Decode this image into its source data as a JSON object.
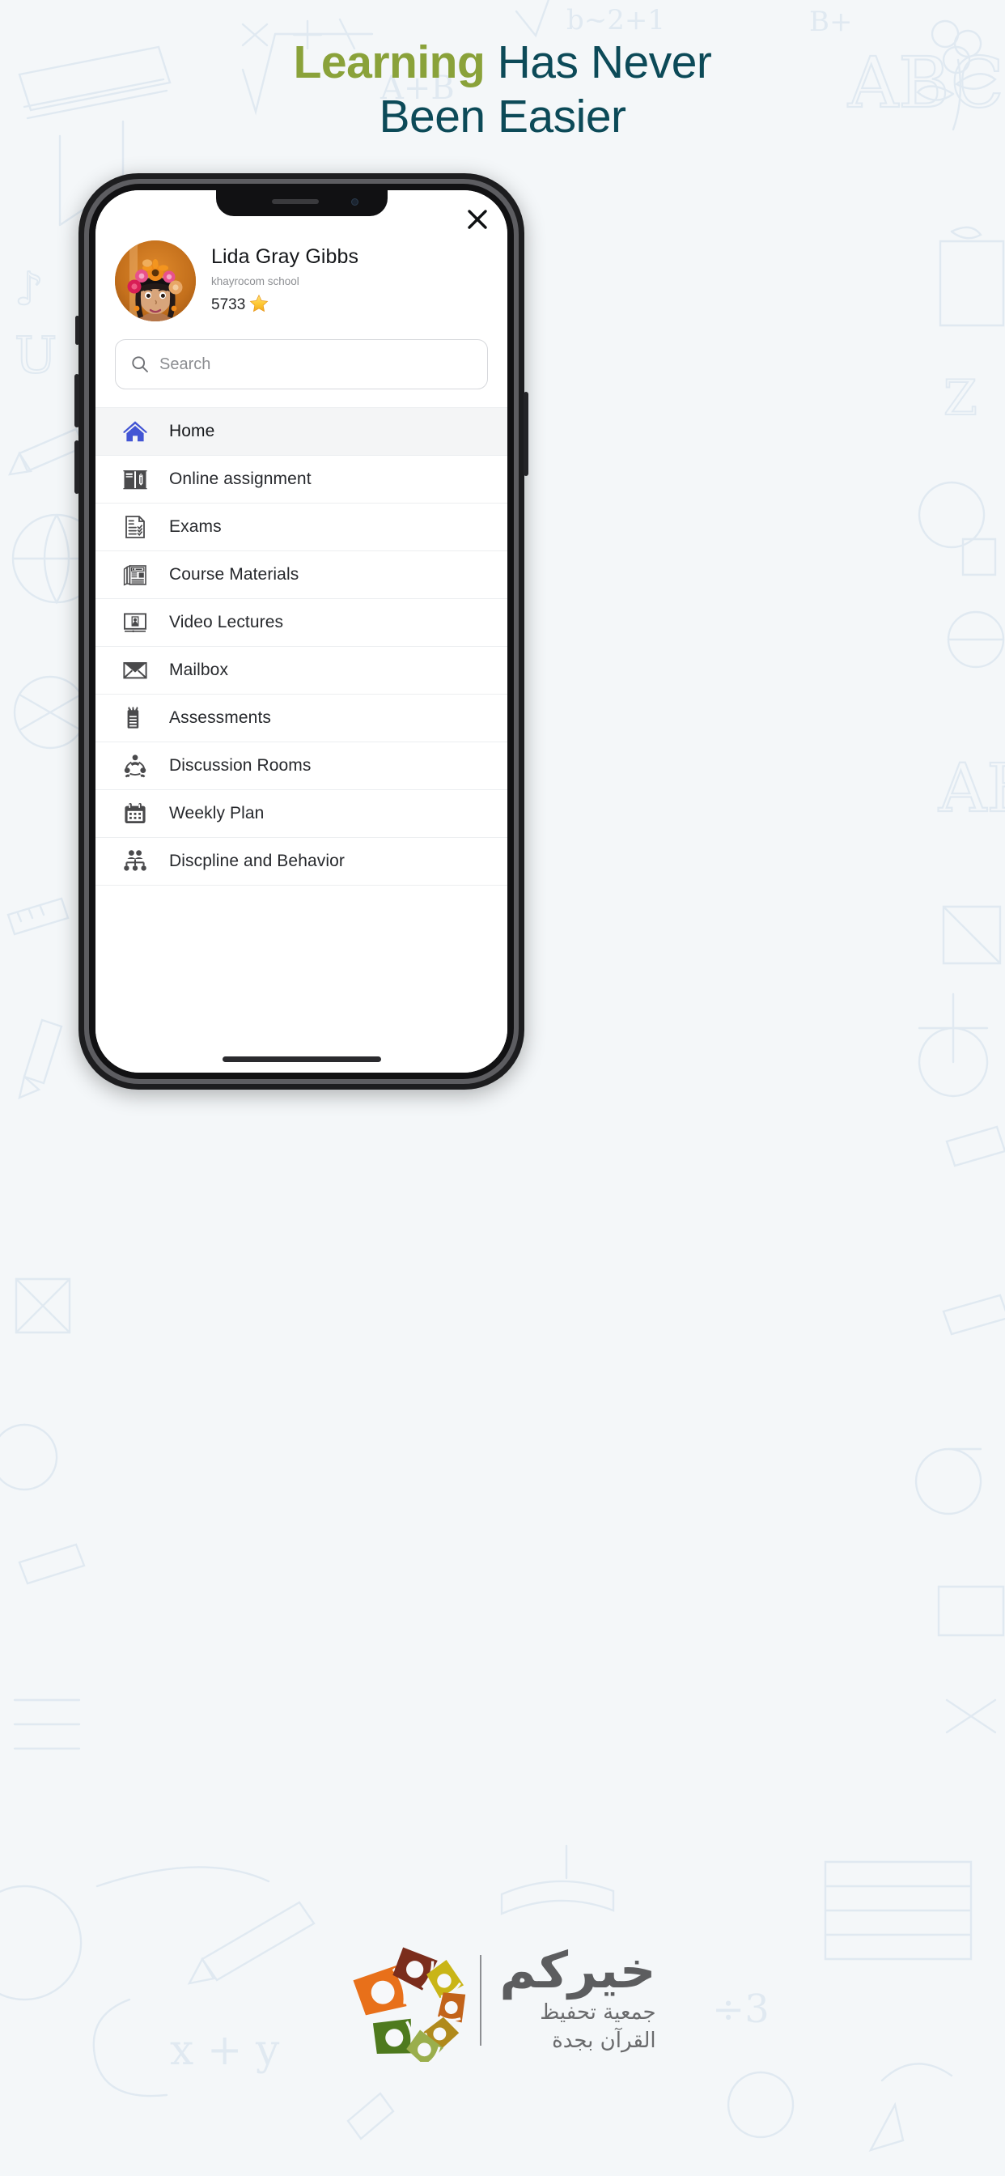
{
  "hero": {
    "line1_green": "Learning",
    "line1_dark": " Has Never",
    "line2": "Been Easier",
    "green_color": "#8aa23a",
    "dark_color": "#0c4a58"
  },
  "app": {
    "close_icon": "close-icon",
    "profile": {
      "name": "Lida Gray Gibbs",
      "school": "khayrocom school",
      "points": "5733",
      "star": "⭐"
    },
    "search": {
      "placeholder": "Search",
      "value": "",
      "icon": "search-icon"
    },
    "menu": [
      {
        "label": "Home",
        "icon": "home-icon",
        "active": true,
        "accent": "#4255d4"
      },
      {
        "label": "Online assignment",
        "icon": "book-pencil-icon",
        "active": false,
        "accent": "#4a4a4c"
      },
      {
        "label": "Exams",
        "icon": "checklist-doc-icon",
        "active": false,
        "accent": "#4a4a4c"
      },
      {
        "label": "Course Materials",
        "icon": "newspaper-icon",
        "active": false,
        "accent": "#4a4a4c"
      },
      {
        "label": "Video Lectures",
        "icon": "video-screen-icon",
        "active": false,
        "accent": "#4a4a4c"
      },
      {
        "label": "Mailbox",
        "icon": "envelope-icon",
        "active": false,
        "accent": "#4a4a4c"
      },
      {
        "label": "Assessments",
        "icon": "notepad-icon",
        "active": false,
        "accent": "#4a4a4c"
      },
      {
        "label": "Discussion Rooms",
        "icon": "people-group-icon",
        "active": false,
        "accent": "#4a4a4c"
      },
      {
        "label": "Weekly Plan",
        "icon": "calendar-icon",
        "active": false,
        "accent": "#4a4a4c"
      },
      {
        "label": "Discpline and Behavior",
        "icon": "org-chart-icon",
        "active": false,
        "accent": "#4a4a4c"
      }
    ]
  },
  "brand": {
    "name_ar": "خيركم",
    "sub1_ar": "جمعية تحفيظ",
    "sub2_ar": "القرآن بجدة",
    "logo_colors": [
      "#e8701a",
      "#7b2d1c",
      "#c9b517",
      "#c2631a",
      "#b08a1c",
      "#4e7a1e",
      "#9aae4c"
    ]
  }
}
